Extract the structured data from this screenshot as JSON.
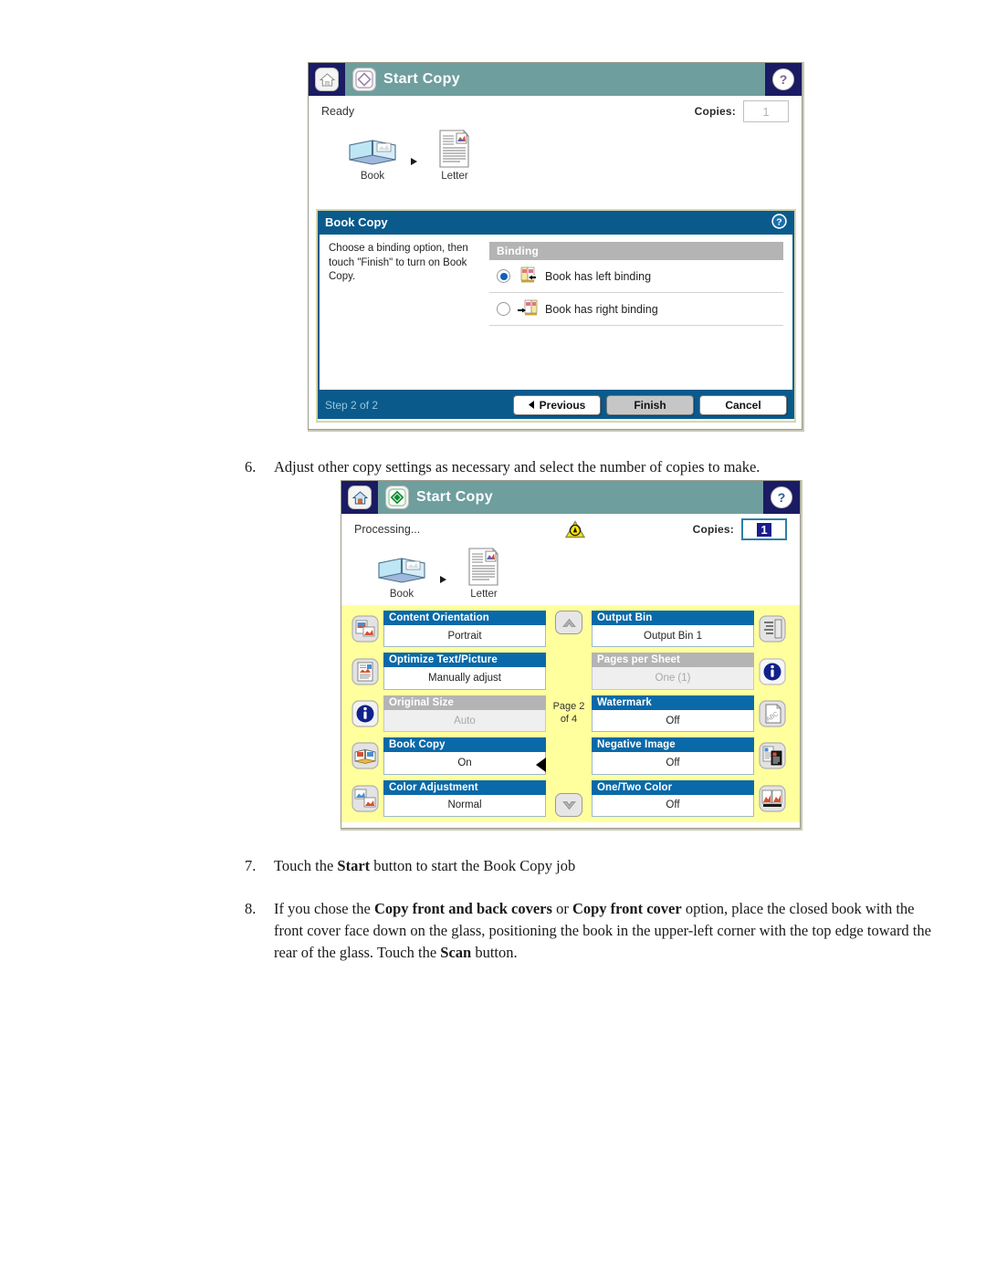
{
  "screen1": {
    "titlebar": {
      "home_icon": "home-icon",
      "start_icon": "start-copy-icon",
      "title": "Start Copy",
      "help_icon": "help-icon"
    },
    "status": "Ready",
    "copies_label": "Copies:",
    "copies_value": "1",
    "originals": [
      {
        "icon": "book-icon",
        "label": "Book"
      },
      {
        "icon": "letter-page-icon",
        "label": "Letter"
      }
    ],
    "modal": {
      "title": "Book Copy",
      "help_icon": "help-icon",
      "instruction": "Choose a binding option, then touch \"Finish\" to turn on Book Copy.",
      "group_header": "Binding",
      "options": [
        {
          "label": "Book has left binding",
          "selected": true,
          "icon": "left-binding-icon"
        },
        {
          "label": "Book has right binding",
          "selected": false,
          "icon": "right-binding-icon"
        }
      ],
      "step": "Step 2 of 2",
      "buttons": [
        {
          "label": "Previous",
          "icon": "left-arrow-icon",
          "style": "white"
        },
        {
          "label": "Finish",
          "icon": "",
          "style": "gray"
        },
        {
          "label": "Cancel",
          "icon": "",
          "style": "white"
        }
      ]
    }
  },
  "screen2": {
    "titlebar": {
      "home_icon": "home-icon",
      "start_icon": "start-copy-icon",
      "title": "Start Copy",
      "help_icon": "help-icon"
    },
    "status": "Processing...",
    "warning_icon": "warning-icon",
    "copies_label": "Copies:",
    "copies_value": "1",
    "originals": [
      {
        "icon": "book-icon",
        "label": "Book"
      },
      {
        "icon": "letter-page-icon",
        "label": "Letter"
      }
    ],
    "page_indicator": "Page 2\nof 4",
    "page_indicator_line1": "Page 2",
    "page_indicator_line2": "of 4",
    "scroll_up_icon": "chevron-up-icon",
    "scroll_down_icon": "chevron-down-icon",
    "settings_left": [
      {
        "caption": "Content Orientation",
        "value": "Portrait",
        "icon": "orientation-icon",
        "disabled": false,
        "pointer": false
      },
      {
        "caption": "Optimize Text/Picture",
        "value": "Manually adjust",
        "icon": "text-picture-icon",
        "disabled": false,
        "pointer": false
      },
      {
        "caption": "Original Size",
        "value": "Auto",
        "icon": "info-icon",
        "disabled": true,
        "pointer": false
      },
      {
        "caption": "Book Copy",
        "value": "On",
        "icon": "book-copy-icon",
        "disabled": false,
        "pointer": true
      },
      {
        "caption": "Color Adjustment",
        "value": "Normal",
        "icon": "color-adjust-icon",
        "disabled": false,
        "pointer": false
      }
    ],
    "settings_right": [
      {
        "caption": "Output Bin",
        "value": "Output Bin 1",
        "icon": "output-bin-icon",
        "disabled": false
      },
      {
        "caption": "Pages per Sheet",
        "value": "One (1)",
        "icon": "info-icon",
        "disabled": true
      },
      {
        "caption": "Watermark",
        "value": "Off",
        "icon": "watermark-icon",
        "disabled": false
      },
      {
        "caption": "Negative Image",
        "value": "Off",
        "icon": "negative-image-icon",
        "disabled": false
      },
      {
        "caption": "One/Two Color",
        "value": "Off",
        "icon": "one-two-color-icon",
        "disabled": false
      }
    ]
  },
  "steps": {
    "six": {
      "num": "6.",
      "text": "Adjust other copy settings as necessary and select the number of copies to make."
    },
    "seven": {
      "num": "7.",
      "pre": "Touch the ",
      "bold1": "Start",
      "post": " button to start the Book Copy job"
    },
    "eight": {
      "num": "8.",
      "p1": "If you chose the ",
      "b1": "Copy front and back covers",
      "p2": " or ",
      "b2": "Copy front cover",
      "p3": " option, place the closed book with the front cover face down on the glass, positioning the book in the upper-left corner with the top edge toward the rear of the glass. Touch the ",
      "b3": "Scan",
      "p4": " button."
    }
  },
  "colors": {
    "titlebar_teal": "#6f9e9e",
    "navy": "#1b1b63",
    "modal_blue": "#0a5a8c",
    "caption_blue": "#0a69a8",
    "settings_yellow": "#ffff9e",
    "disabled_gray": "#b4b4b4"
  }
}
